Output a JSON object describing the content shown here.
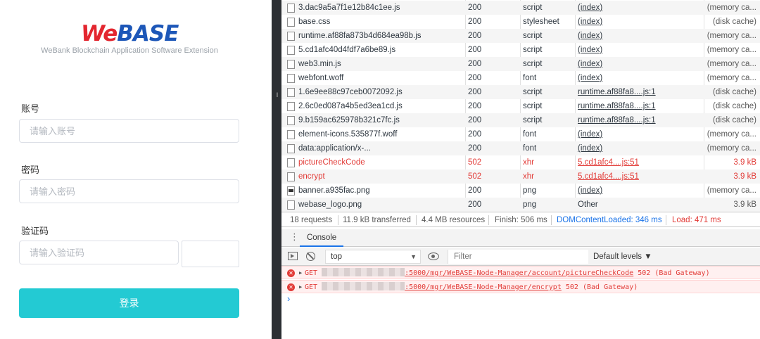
{
  "login": {
    "logo": {
      "we": "We",
      "base": "BASE"
    },
    "subtitle": "WeBank Blockchain Application Software Extension",
    "account_label": "账号",
    "account_placeholder": "请输入账号",
    "password_label": "密码",
    "password_placeholder": "请输入密码",
    "captcha_label": "验证码",
    "captcha_placeholder": "请输入验证码",
    "login_button": "登录"
  },
  "network": {
    "requests": [
      {
        "name": "3.dac9a5a7f1e12b84c1ee.js",
        "status": "200",
        "type": "script",
        "initiator": "(index)",
        "size": "(memory ca...",
        "error": false,
        "icon": "file-icon"
      },
      {
        "name": "base.css",
        "status": "200",
        "type": "stylesheet",
        "initiator": "(index)",
        "size": "(disk cache)",
        "error": false,
        "icon": "file-icon"
      },
      {
        "name": "runtime.af88fa873b4d684ea98b.js",
        "status": "200",
        "type": "script",
        "initiator": "(index)",
        "size": "(memory ca...",
        "error": false,
        "icon": "file-icon"
      },
      {
        "name": "5.cd1afc40d4fdf7a6be89.js",
        "status": "200",
        "type": "script",
        "initiator": "(index)",
        "size": "(memory ca...",
        "error": false,
        "icon": "file-icon"
      },
      {
        "name": "web3.min.js",
        "status": "200",
        "type": "script",
        "initiator": "(index)",
        "size": "(memory ca...",
        "error": false,
        "icon": "file-icon"
      },
      {
        "name": "webfont.woff",
        "status": "200",
        "type": "font",
        "initiator": "(index)",
        "size": "(memory ca...",
        "error": false,
        "icon": "file-icon"
      },
      {
        "name": "1.6e9ee88c97ceb0072092.js",
        "status": "200",
        "type": "script",
        "initiator": "runtime.af88fa8....js:1",
        "size": "(disk cache)",
        "error": false,
        "icon": "file-icon"
      },
      {
        "name": "2.6c0ed087a4b5ed3ea1cd.js",
        "status": "200",
        "type": "script",
        "initiator": "runtime.af88fa8....js:1",
        "size": "(disk cache)",
        "error": false,
        "icon": "file-icon"
      },
      {
        "name": "9.b159ac625978b321c7fc.js",
        "status": "200",
        "type": "script",
        "initiator": "runtime.af88fa8....js:1",
        "size": "(disk cache)",
        "error": false,
        "icon": "file-icon"
      },
      {
        "name": "element-icons.535877f.woff",
        "status": "200",
        "type": "font",
        "initiator": "(index)",
        "size": "(memory ca...",
        "error": false,
        "icon": "file-icon"
      },
      {
        "name": "data:application/x-...",
        "status": "200",
        "type": "font",
        "initiator": "(index)",
        "size": "(memory ca...",
        "error": false,
        "icon": "file-icon"
      },
      {
        "name": "pictureCheckCode",
        "status": "502",
        "type": "xhr",
        "initiator": "5.cd1afc4....js:51",
        "size": "3.9 kB",
        "error": true,
        "icon": "file-icon"
      },
      {
        "name": "encrypt",
        "status": "502",
        "type": "xhr",
        "initiator": "5.cd1afc4....js:51",
        "size": "3.9 kB",
        "error": true,
        "icon": "file-icon"
      },
      {
        "name": "banner.a935fac.png",
        "status": "200",
        "type": "png",
        "initiator": "(index)",
        "size": "(memory ca...",
        "error": false,
        "icon": "image-file-icon"
      },
      {
        "name": "webase_logo.png",
        "status": "200",
        "type": "png",
        "initiator": "Other",
        "size": "3.9 kB",
        "error": false,
        "icon": "file-icon"
      }
    ],
    "summary": {
      "requests": "18 requests",
      "transferred": "11.9 kB transferred",
      "resources": "4.4 MB resources",
      "finish": "Finish: 506 ms",
      "dom_content_loaded": "DOMContentLoaded: 346 ms",
      "load": "Load: 471 ms"
    }
  },
  "console": {
    "tab_label": "Console",
    "context": "top",
    "filter_placeholder": "Filter",
    "levels": "Default levels ▼",
    "messages": [
      {
        "method": "GET",
        "url_suffix": ":5000/mgr/WeBASE-Node-Manager/account/pictureCheckCode",
        "status": "502 (Bad Gateway)"
      },
      {
        "method": "GET",
        "url_suffix": ":5000/mgr/WeBASE-Node-Manager/encrypt",
        "status": "502 (Bad Gateway)"
      }
    ],
    "prompt": "›"
  },
  "colors": {
    "accent_button": "#23cad3",
    "error_red": "#e23b37",
    "devtools_blue": "#1a73e8",
    "logo_red": "#e3262f",
    "logo_blue": "#1d57b8"
  }
}
